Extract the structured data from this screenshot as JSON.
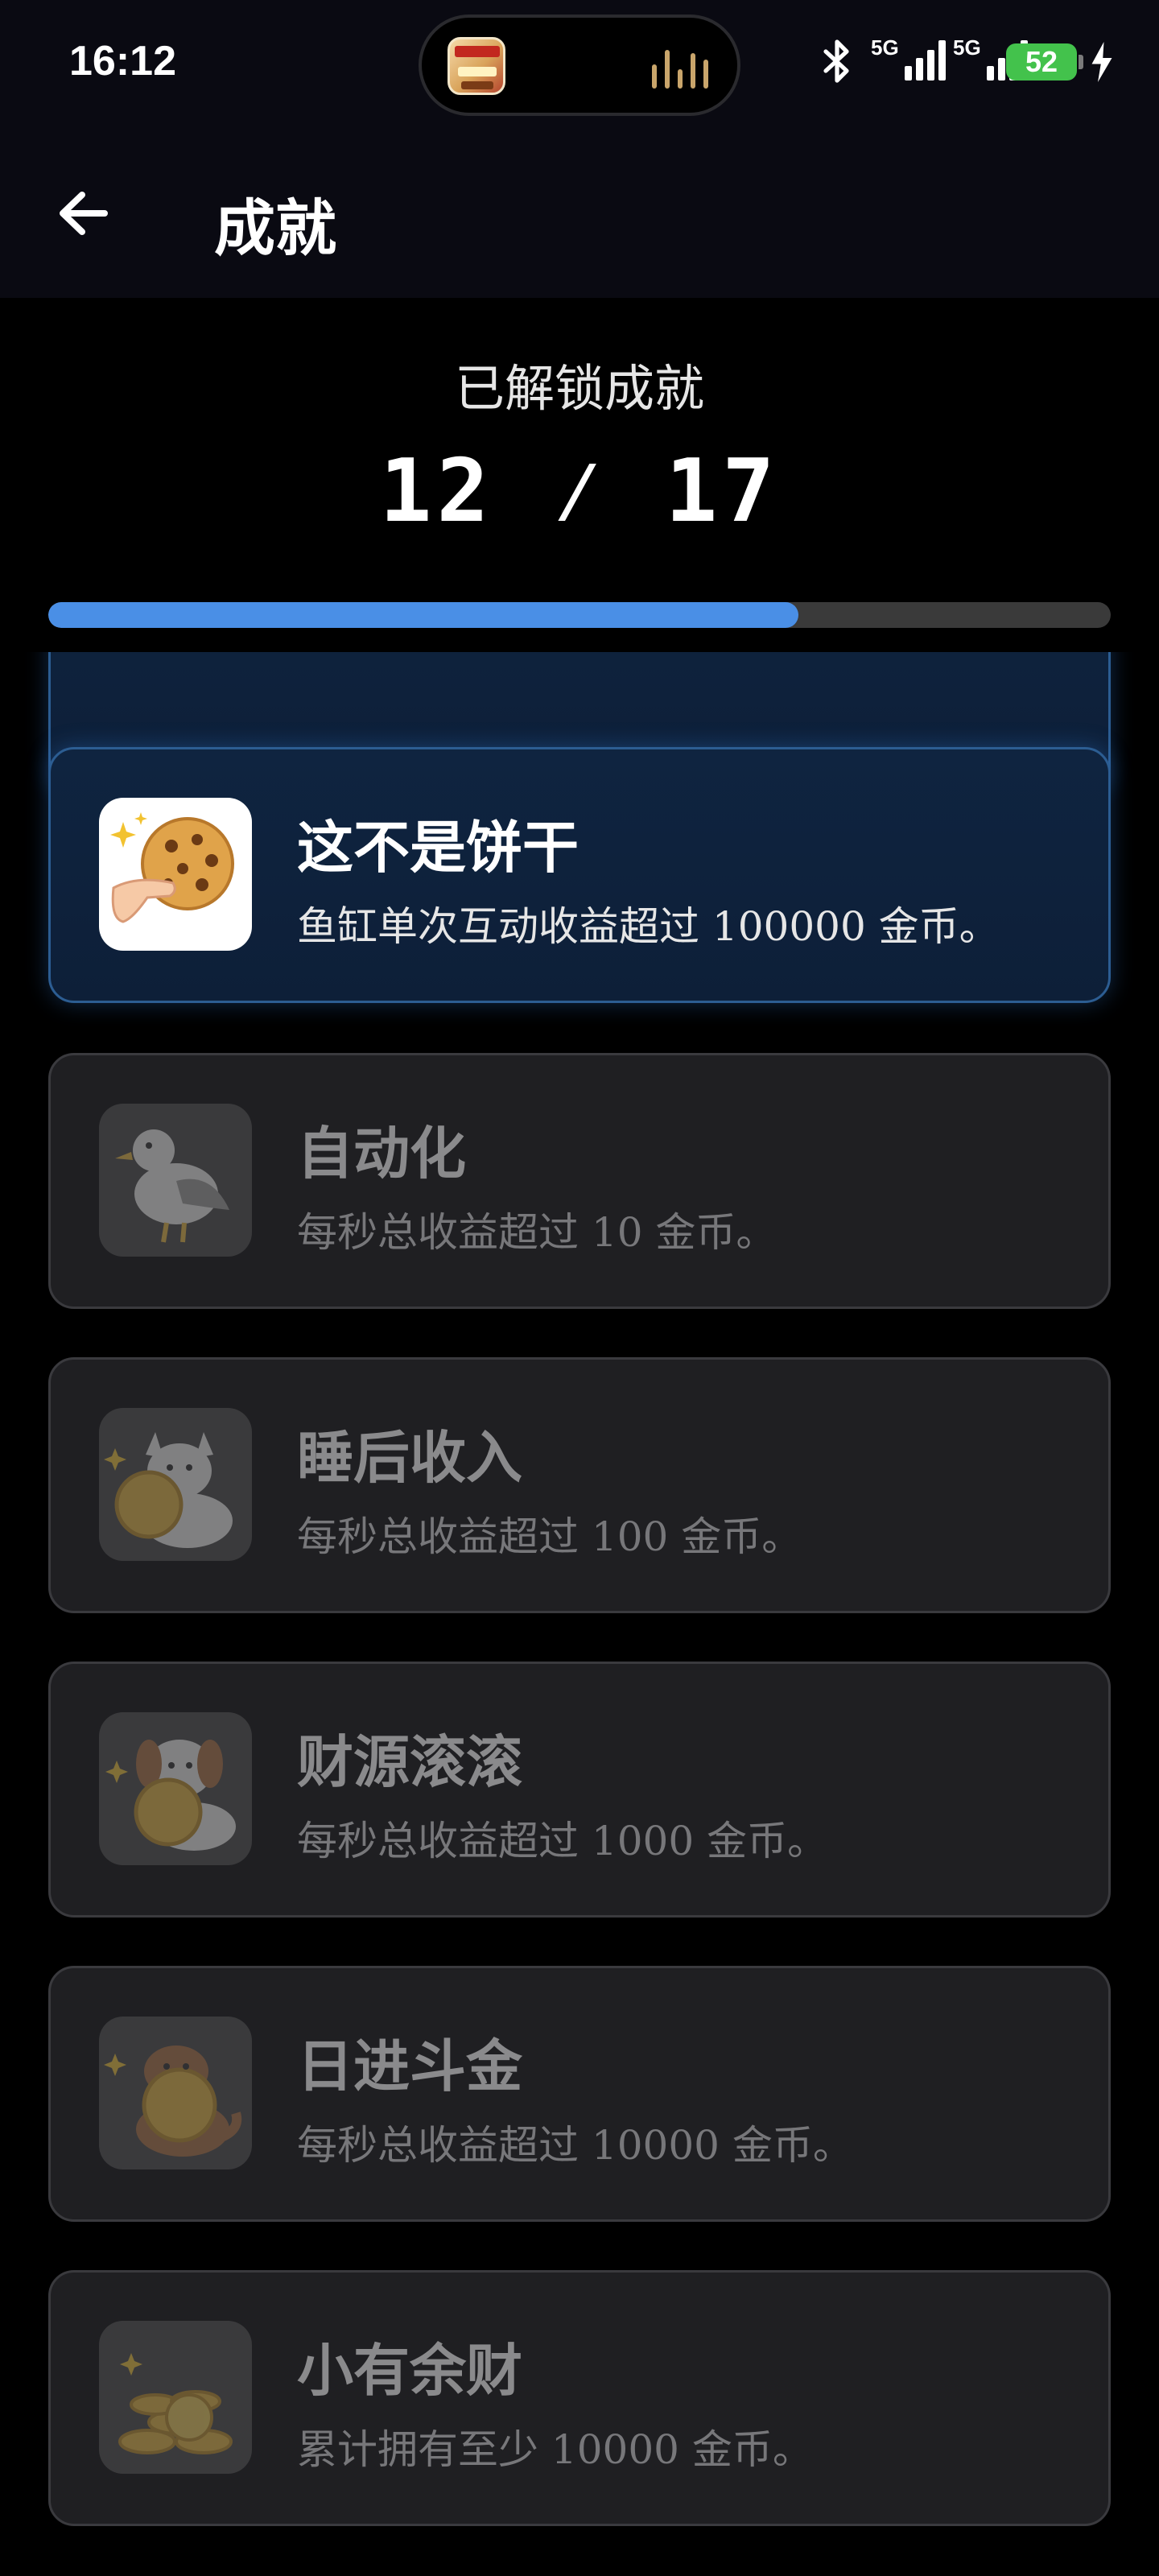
{
  "status_bar": {
    "time": "16:12",
    "network_1": "5G",
    "network_2": "5G",
    "battery": "52"
  },
  "app_bar": {
    "title": "成就"
  },
  "summary": {
    "label": "已解锁成就",
    "unlocked": 12,
    "total": 17,
    "count_text": "12 ⁄ 17",
    "progress_fraction": 0.706,
    "progress_color": "#4a8fe6"
  },
  "achievements": [
    {
      "id": "cookie",
      "title": "这不是饼干",
      "desc": "鱼缸单次互动收益超过 100000 金币。",
      "unlocked": true,
      "icon": "cookie-hand-icon"
    },
    {
      "id": "auto",
      "title": "自动化",
      "desc": "每秒总收益超过 10 金币。",
      "unlocked": false,
      "icon": "seagull-icon"
    },
    {
      "id": "sleep",
      "title": "睡后收入",
      "desc": "每秒总收益超过 100 金币。",
      "unlocked": false,
      "icon": "cat-coin-icon"
    },
    {
      "id": "wealth",
      "title": "财源滚滚",
      "desc": "每秒总收益超过 1000 金币。",
      "unlocked": false,
      "icon": "dog-coin-icon"
    },
    {
      "id": "daily",
      "title": "日进斗金",
      "desc": "每秒总收益超过 10000 金币。",
      "unlocked": false,
      "icon": "otter-coin-icon"
    },
    {
      "id": "small",
      "title": "小有余财",
      "desc": "累计拥有至少 10000 金币。",
      "unlocked": false,
      "icon": "coin-pile-icon"
    }
  ],
  "colors": {
    "unlocked_card_bg": "#0f2440",
    "unlocked_card_border": "#2c5d92",
    "locked_card_bg": "#1f1f22",
    "locked_text": "#8a8a8c"
  }
}
